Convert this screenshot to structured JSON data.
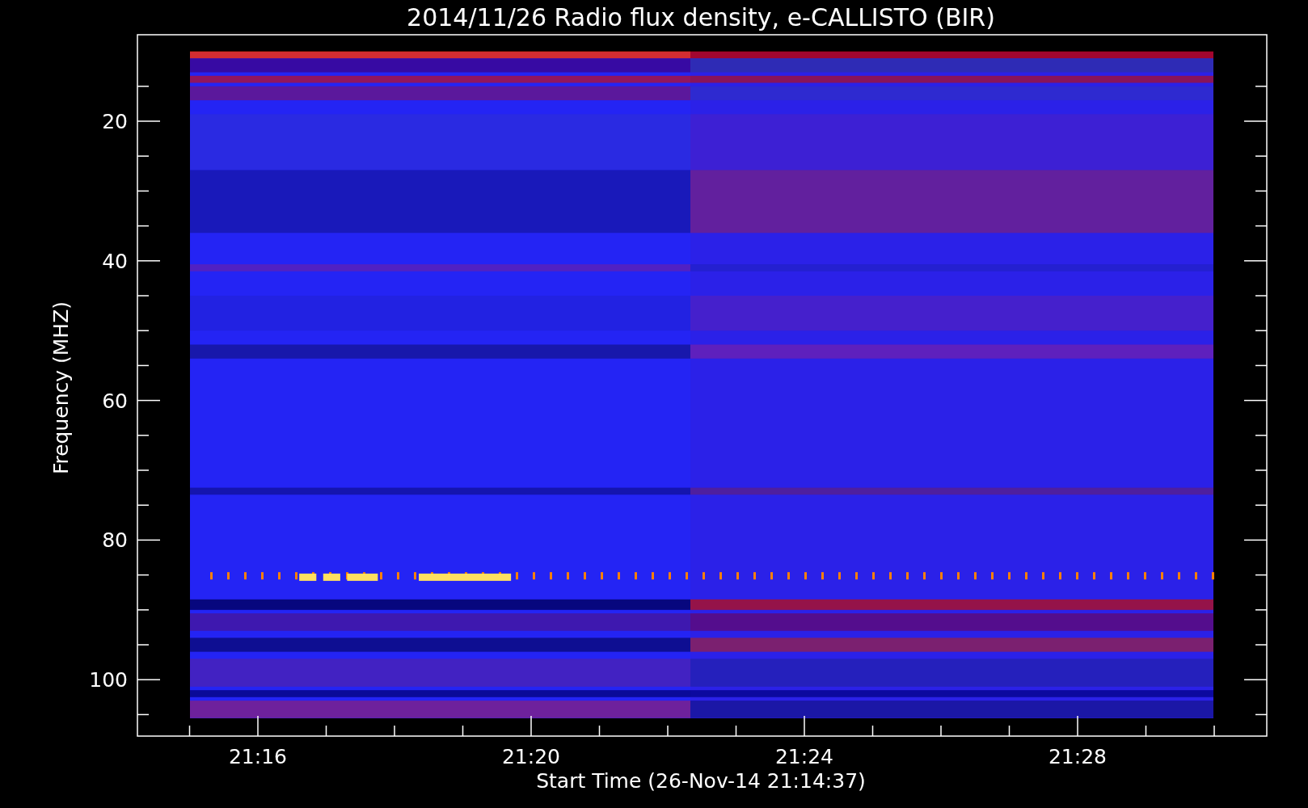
{
  "title": "2014/11/26  Radio flux density, e-CALLISTO (BIR)",
  "y_axis": {
    "label": "Frequency (MHZ)",
    "ticks": [
      "20",
      "40",
      "60",
      "80",
      "100"
    ]
  },
  "x_axis": {
    "label": "Start Time (26-Nov-14 21:14:37)",
    "ticks": [
      "21:16",
      "21:20",
      "21:24",
      "21:28"
    ]
  }
}
